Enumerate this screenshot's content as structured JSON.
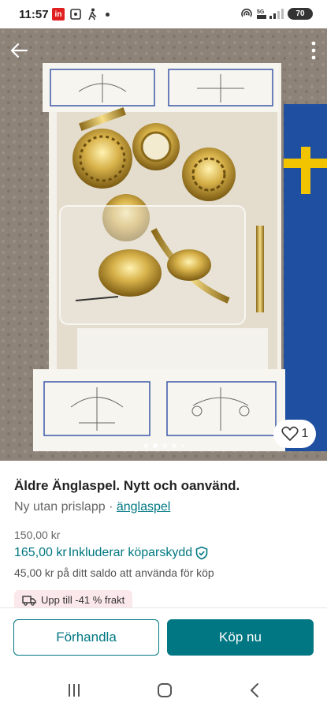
{
  "status_bar": {
    "time": "11:57",
    "app_badge": "in",
    "battery": "70",
    "icons": [
      "linkedin-icon",
      "screenshot-icon",
      "walking-icon",
      "notification-dot-icon",
      "hotspot-icon",
      "5g-signal-icon",
      "battery-icon"
    ]
  },
  "photo": {
    "favorite_count": "1",
    "page_dots": 5,
    "active_dot": 1
  },
  "item": {
    "title": "Äldre Änglaspel. Nytt och oanvänd.",
    "condition": "Ny utan prislapp",
    "separator": " · ",
    "brand": "änglaspel",
    "price": "150,00 kr",
    "price_with_protection": "165,00 kr",
    "protection_label": "Inkluderar köparskydd",
    "balance_note": "45,00 kr på ditt saldo att använda för köp",
    "shipping_badge": "Upp till -41 % frakt"
  },
  "actions": {
    "negotiate": "Förhandla",
    "buy": "Köp nu"
  },
  "colors": {
    "accent": "#007782",
    "shipping_chip": "#fbe8ea"
  }
}
